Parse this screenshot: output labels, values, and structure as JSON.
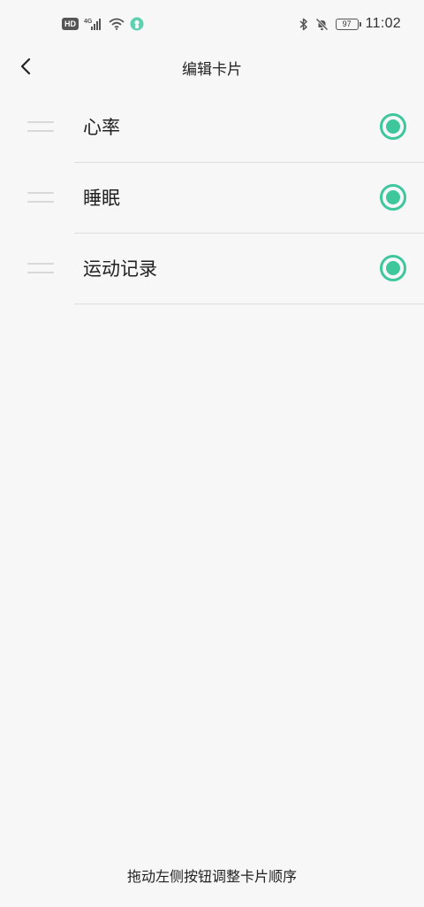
{
  "status_bar": {
    "hd_badge": "HD",
    "signal_label": "4G",
    "battery_level": "97",
    "time": "11:02",
    "icons": [
      "hd-icon",
      "signal-icon",
      "wifi-icon",
      "app-notification-icon",
      "bluetooth-icon",
      "mute-icon",
      "battery-icon"
    ]
  },
  "header": {
    "title": "编辑卡片",
    "back_icon": "chevron-left-icon"
  },
  "cards": [
    {
      "label": "心率",
      "selected": true
    },
    {
      "label": "睡眠",
      "selected": true
    },
    {
      "label": "运动记录",
      "selected": true
    }
  ],
  "footer": {
    "hint": "拖动左侧按钮调整卡片顺序"
  },
  "colors": {
    "accent": "#3ec79b",
    "background": "#f7f7f7",
    "divider": "#dedede",
    "drag_handle": "#d8d8d8"
  }
}
